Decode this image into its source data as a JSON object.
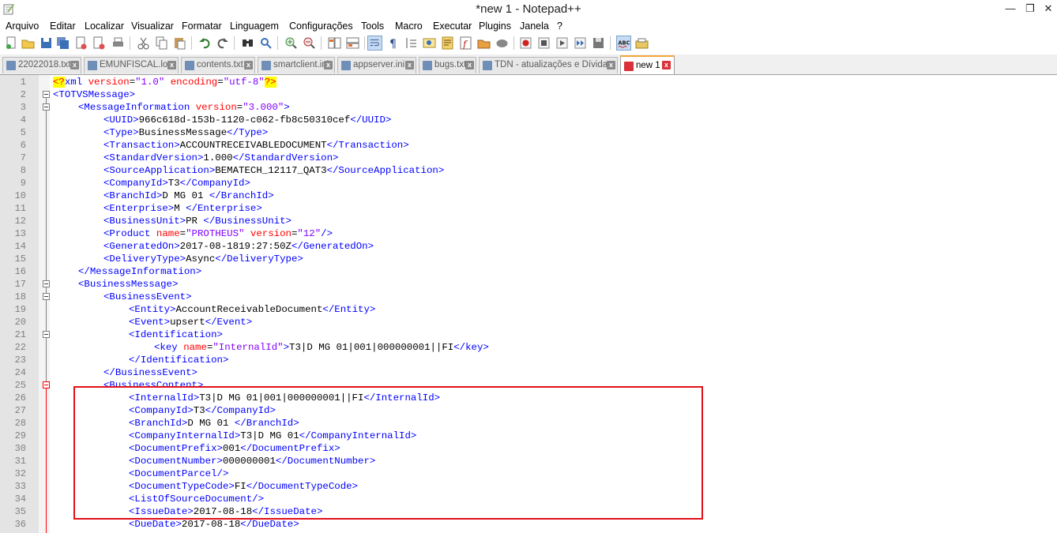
{
  "window": {
    "title": "*new 1 - Notepad++"
  },
  "menu": [
    "Arquivo",
    "Editar",
    "Localizar",
    "Visualizar",
    "Formatar",
    "Linguagem",
    "Configurações",
    "Tools",
    "Macro",
    "Executar",
    "Plugins",
    "Janela",
    "?"
  ],
  "toolbar": {
    "icons": [
      "new-file-icon",
      "open-file-icon",
      "save-icon",
      "save-all-icon",
      "close-icon",
      "close-all-icon",
      "print-icon",
      "cut-icon",
      "copy-icon",
      "paste-icon",
      "undo-icon",
      "redo-icon",
      "find-icon",
      "replace-icon",
      "zoom-in-icon",
      "zoom-out-icon",
      "sync-vertical-icon",
      "sync-horizontal-icon",
      "word-wrap-icon",
      "show-all-chars-icon",
      "indent-guide-icon",
      "user-language-icon",
      "doc-map-icon",
      "function-list-icon",
      "folder-workspace-icon",
      "monitor-icon",
      "record-macro-icon",
      "stop-record-icon",
      "play-macro-icon",
      "run-macro-multiple-icon",
      "save-macro-icon",
      "spell-check-icon",
      "spell-settings-icon"
    ]
  },
  "tabs": [
    {
      "label": "22022018.txt",
      "color": "#6f8fb8"
    },
    {
      "label": "EMUNFISCAL.log",
      "color": "#6f8fb8"
    },
    {
      "label": "contents.txt",
      "color": "#6f8fb8"
    },
    {
      "label": "smartclient.ini",
      "color": "#6f8fb8"
    },
    {
      "label": "appserver.ini",
      "color": "#6f8fb8"
    },
    {
      "label": "bugs.txt",
      "color": "#6f8fb8"
    },
    {
      "label": "TDN - atualizações e Dívidas",
      "color": "#6f8fb8"
    },
    {
      "label": "new 1",
      "color": "#d9323a",
      "active": true
    }
  ],
  "editor": {
    "lines": [
      {
        "n": "1",
        "indent": 0,
        "tokens": [
          [
            "pi",
            "<?"
          ],
          [
            "t",
            "xml "
          ],
          [
            "a",
            "version"
          ],
          [
            "x",
            "="
          ],
          [
            "v",
            "\"1.0\""
          ],
          [
            "t",
            " "
          ],
          [
            "a",
            "encoding"
          ],
          [
            "x",
            "="
          ],
          [
            "v",
            "\"utf-8\""
          ],
          [
            "pi",
            "?>"
          ]
        ]
      },
      {
        "n": "2",
        "indent": 0,
        "tokens": [
          [
            "t",
            "<TOTVSMessage>"
          ]
        ]
      },
      {
        "n": "3",
        "indent": 1,
        "tokens": [
          [
            "t",
            "<MessageInformation "
          ],
          [
            "a",
            "version"
          ],
          [
            "x",
            "="
          ],
          [
            "v",
            "\"3.000\""
          ],
          [
            "t",
            ">"
          ]
        ]
      },
      {
        "n": "4",
        "indent": 2,
        "tokens": [
          [
            "t",
            "<UUID>"
          ],
          [
            "x",
            "966c618d-153b-1120-c062-fb8c50310cef"
          ],
          [
            "t",
            "</UUID>"
          ]
        ]
      },
      {
        "n": "5",
        "indent": 2,
        "tokens": [
          [
            "t",
            "<Type>"
          ],
          [
            "x",
            "BusinessMessage"
          ],
          [
            "t",
            "</Type>"
          ]
        ]
      },
      {
        "n": "6",
        "indent": 2,
        "tokens": [
          [
            "t",
            "<Transaction>"
          ],
          [
            "x",
            "ACCOUNTRECEIVABLEDOCUMENT"
          ],
          [
            "t",
            "</Transaction>"
          ]
        ]
      },
      {
        "n": "7",
        "indent": 2,
        "tokens": [
          [
            "t",
            "<StandardVersion>"
          ],
          [
            "x",
            "1.000"
          ],
          [
            "t",
            "</StandardVersion>"
          ]
        ]
      },
      {
        "n": "8",
        "indent": 2,
        "tokens": [
          [
            "t",
            "<SourceApplication>"
          ],
          [
            "x",
            "BEMATECH_12117_QAT3"
          ],
          [
            "t",
            "</SourceApplication>"
          ]
        ]
      },
      {
        "n": "9",
        "indent": 2,
        "tokens": [
          [
            "t",
            "<CompanyId>"
          ],
          [
            "x",
            "T3"
          ],
          [
            "t",
            "</CompanyId>"
          ]
        ]
      },
      {
        "n": "10",
        "indent": 2,
        "tokens": [
          [
            "t",
            "<BranchId>"
          ],
          [
            "x",
            "D MG 01 "
          ],
          [
            "t",
            "</BranchId>"
          ]
        ]
      },
      {
        "n": "11",
        "indent": 2,
        "tokens": [
          [
            "t",
            "<Enterprise>"
          ],
          [
            "x",
            "M "
          ],
          [
            "t",
            "</Enterprise>"
          ]
        ]
      },
      {
        "n": "12",
        "indent": 2,
        "tokens": [
          [
            "t",
            "<BusinessUnit>"
          ],
          [
            "x",
            "PR "
          ],
          [
            "t",
            "</BusinessUnit>"
          ]
        ]
      },
      {
        "n": "13",
        "indent": 2,
        "tokens": [
          [
            "t",
            "<Product "
          ],
          [
            "a",
            "name"
          ],
          [
            "x",
            "="
          ],
          [
            "v",
            "\"PROTHEUS\""
          ],
          [
            "t",
            " "
          ],
          [
            "a",
            "version"
          ],
          [
            "x",
            "="
          ],
          [
            "v",
            "\"12\""
          ],
          [
            "t",
            "/>"
          ]
        ]
      },
      {
        "n": "14",
        "indent": 2,
        "tokens": [
          [
            "t",
            "<GeneratedOn>"
          ],
          [
            "x",
            "2017-08-1819:27:50Z"
          ],
          [
            "t",
            "</GeneratedOn>"
          ]
        ]
      },
      {
        "n": "15",
        "indent": 2,
        "tokens": [
          [
            "t",
            "<DeliveryType>"
          ],
          [
            "x",
            "Async"
          ],
          [
            "t",
            "</DeliveryType>"
          ]
        ]
      },
      {
        "n": "16",
        "indent": 1,
        "tokens": [
          [
            "t",
            "</MessageInformation>"
          ]
        ]
      },
      {
        "n": "17",
        "indent": 1,
        "tokens": [
          [
            "t",
            "<BusinessMessage>"
          ]
        ]
      },
      {
        "n": "18",
        "indent": 2,
        "tokens": [
          [
            "t",
            "<BusinessEvent>"
          ]
        ]
      },
      {
        "n": "19",
        "indent": 3,
        "tokens": [
          [
            "t",
            "<Entity>"
          ],
          [
            "x",
            "AccountReceivableDocument"
          ],
          [
            "t",
            "</Entity>"
          ]
        ]
      },
      {
        "n": "20",
        "indent": 3,
        "tokens": [
          [
            "t",
            "<Event>"
          ],
          [
            "x",
            "upsert"
          ],
          [
            "t",
            "</Event>"
          ]
        ]
      },
      {
        "n": "21",
        "indent": 3,
        "tokens": [
          [
            "t",
            "<Identification>"
          ]
        ]
      },
      {
        "n": "22",
        "indent": 4,
        "tokens": [
          [
            "t",
            "<key "
          ],
          [
            "a",
            "name"
          ],
          [
            "x",
            "="
          ],
          [
            "v",
            "\"InternalId\""
          ],
          [
            "t",
            ">"
          ],
          [
            "x",
            "T3|D MG 01|001|000000001||FI"
          ],
          [
            "t",
            "</key>"
          ]
        ]
      },
      {
        "n": "23",
        "indent": 3,
        "tokens": [
          [
            "t",
            "</Identification>"
          ]
        ]
      },
      {
        "n": "24",
        "indent": 2,
        "tokens": [
          [
            "t",
            "</BusinessEvent>"
          ]
        ]
      },
      {
        "n": "25",
        "indent": 2,
        "tokens": [
          [
            "t",
            "<BusinessContent>"
          ]
        ]
      },
      {
        "n": "26",
        "indent": 3,
        "tokens": [
          [
            "t",
            "<InternalId>"
          ],
          [
            "x",
            "T3|D MG 01|001|000000001||FI"
          ],
          [
            "t",
            "</InternalId>"
          ]
        ]
      },
      {
        "n": "27",
        "indent": 3,
        "tokens": [
          [
            "t",
            "<CompanyId>"
          ],
          [
            "x",
            "T3"
          ],
          [
            "t",
            "</CompanyId>"
          ]
        ]
      },
      {
        "n": "28",
        "indent": 3,
        "tokens": [
          [
            "t",
            "<BranchId>"
          ],
          [
            "x",
            "D MG 01 "
          ],
          [
            "t",
            "</BranchId>"
          ]
        ]
      },
      {
        "n": "29",
        "indent": 3,
        "tokens": [
          [
            "t",
            "<CompanyInternalId>"
          ],
          [
            "x",
            "T3|D MG 01"
          ],
          [
            "t",
            "</CompanyInternalId>"
          ]
        ]
      },
      {
        "n": "30",
        "indent": 3,
        "tokens": [
          [
            "t",
            "<DocumentPrefix>"
          ],
          [
            "x",
            "001"
          ],
          [
            "t",
            "</DocumentPrefix>"
          ]
        ]
      },
      {
        "n": "31",
        "indent": 3,
        "tokens": [
          [
            "t",
            "<DocumentNumber>"
          ],
          [
            "x",
            "000000001"
          ],
          [
            "t",
            "</DocumentNumber>"
          ]
        ]
      },
      {
        "n": "32",
        "indent": 3,
        "tokens": [
          [
            "t",
            "<DocumentParcel/>"
          ]
        ]
      },
      {
        "n": "33",
        "indent": 3,
        "tokens": [
          [
            "t",
            "<DocumentTypeCode>"
          ],
          [
            "x",
            "FI"
          ],
          [
            "t",
            "</DocumentTypeCode>"
          ]
        ]
      },
      {
        "n": "34",
        "indent": 3,
        "tokens": [
          [
            "t",
            "<ListOfSourceDocument/>"
          ]
        ]
      },
      {
        "n": "35",
        "indent": 3,
        "tokens": [
          [
            "t",
            "<IssueDate>"
          ],
          [
            "x",
            "2017-08-18"
          ],
          [
            "t",
            "</IssueDate>"
          ]
        ]
      },
      {
        "n": "36",
        "indent": 3,
        "tokens": [
          [
            "t",
            "<DueDate>"
          ],
          [
            "x",
            "2017-08-18"
          ],
          [
            "t",
            "</DueDate>"
          ]
        ]
      }
    ]
  },
  "colors": {
    "tag": "#0000ff",
    "attr": "#ff0000",
    "value": "#8000ff",
    "annotation_box": "#e0101a"
  }
}
